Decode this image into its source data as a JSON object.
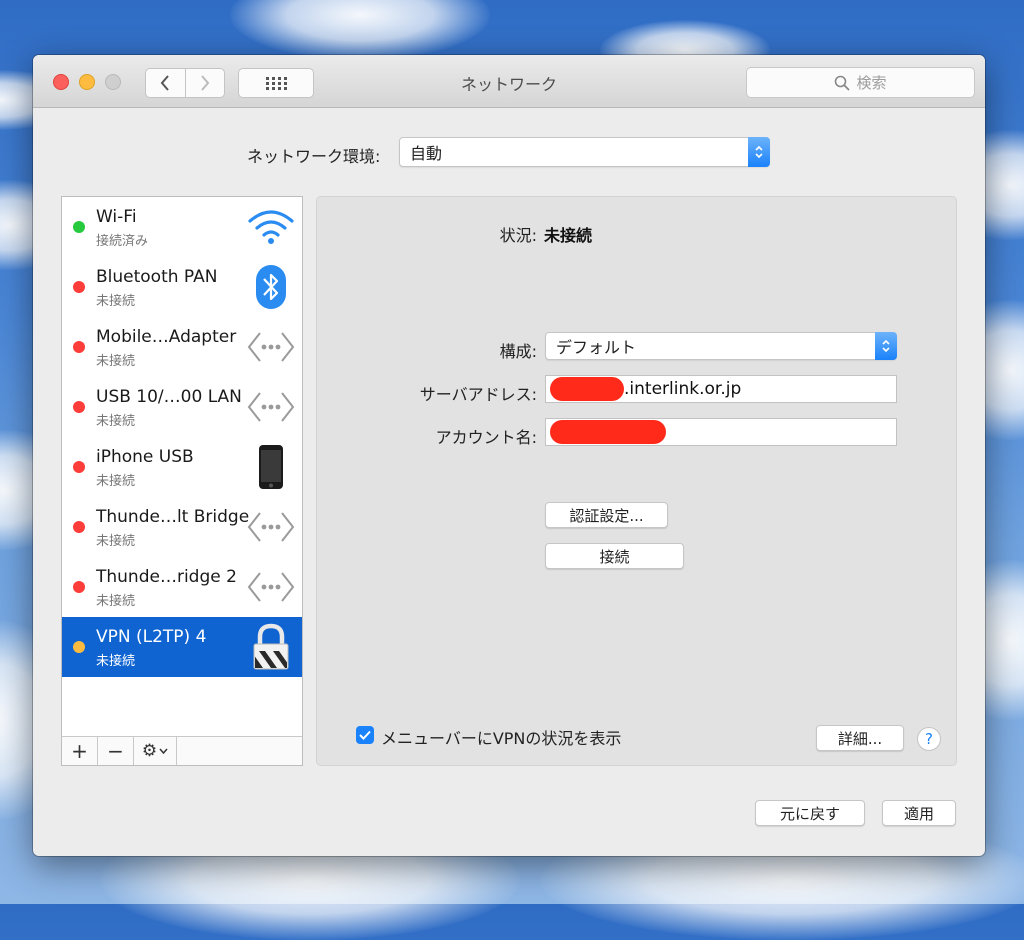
{
  "window": {
    "title": "ネットワーク"
  },
  "toolbar": {
    "search_placeholder": "検索"
  },
  "location": {
    "label": "ネットワーク環境:",
    "value": "自動"
  },
  "services": [
    {
      "name": "Wi-Fi",
      "status": "接続済み",
      "status_color": "#27c93f",
      "icon": "wifi-icon"
    },
    {
      "name": "Bluetooth PAN",
      "status": "未接続",
      "status_color": "#fc3d39",
      "icon": "bluetooth-icon"
    },
    {
      "name": "Mobile…Adapter",
      "status": "未接続",
      "status_color": "#fc3d39",
      "icon": "ethernet-icon"
    },
    {
      "name": "USB 10/…00 LAN",
      "status": "未接続",
      "status_color": "#fc3d39",
      "icon": "ethernet-icon"
    },
    {
      "name": "iPhone USB",
      "status": "未接続",
      "status_color": "#fc3d39",
      "icon": "iphone-icon"
    },
    {
      "name": "Thunde…lt Bridge",
      "status": "未接続",
      "status_color": "#fc3d39",
      "icon": "ethernet-icon"
    },
    {
      "name": "Thunde…ridge 2",
      "status": "未接続",
      "status_color": "#fc3d39",
      "icon": "ethernet-icon"
    },
    {
      "name": "VPN (L2TP) 4",
      "status": "未接続",
      "status_color": "#fdbc40",
      "icon": "lock-icon",
      "selected": true
    }
  ],
  "sidebar_toolbar": {
    "add": "+",
    "remove": "−",
    "gear": "⚙"
  },
  "detail": {
    "status_label": "状況:",
    "status_value": "未接続",
    "config_label": "構成:",
    "config_value": "デフォルト",
    "server_label": "サーバアドレス:",
    "server_value_visible": ".interlink.or.jp",
    "account_label": "アカウント名:",
    "auth_button": "認証設定...",
    "connect_button": "接続",
    "show_vpn_status_label": "メニューバーにVPNの状況を表示",
    "show_vpn_status_checked": true,
    "advanced_button": "詳細...",
    "help_button": "?"
  },
  "footer": {
    "revert_button": "元に戻す",
    "apply_button": "適用"
  },
  "colors": {
    "accent": "#1a82fb",
    "selection": "#0f64d2",
    "redaction": "#ff2a1a"
  }
}
